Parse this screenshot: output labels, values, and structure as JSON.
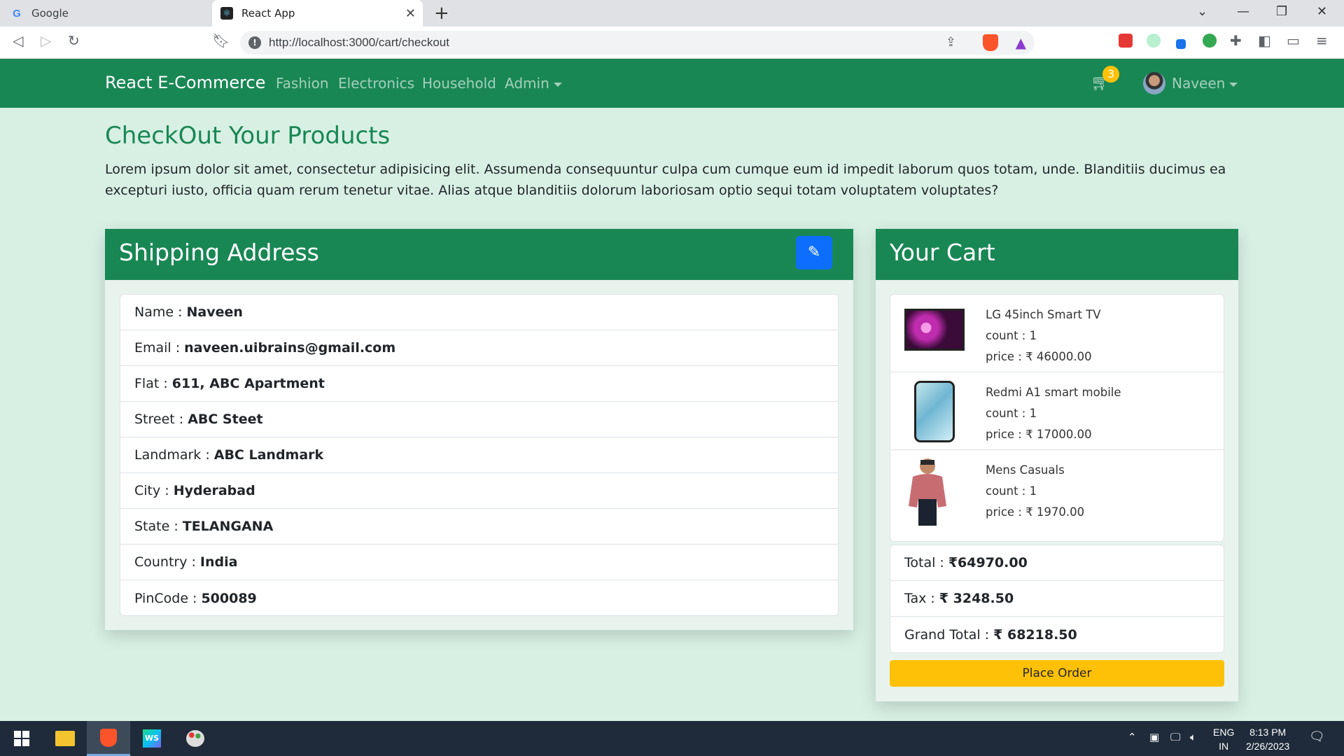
{
  "browser": {
    "tabs": [
      {
        "title": "Google",
        "icon": "google-icon",
        "active": false
      },
      {
        "title": "React App",
        "icon": "react-icon",
        "active": true
      }
    ],
    "url": "http://localhost:3000/cart/checkout"
  },
  "navbar": {
    "brand": "React E-Commerce",
    "links": [
      "Fashion",
      "Electronics",
      "Household"
    ],
    "admin": "Admin",
    "cart_count": "3",
    "user": "Naveen",
    "bg_color": "#198754"
  },
  "page": {
    "title": "CheckOut Your Products",
    "intro": "Lorem ipsum dolor sit amet, consectetur adipisicing elit. Assumenda consequuntur culpa cum cumque eum id impedit laborum quos totam, unde. Blanditiis ducimus ea excepturi iusto, officia quam rerum tenetur vitae. Alias atque blanditiis dolorum laboriosam optio sequi totam voluptatem voluptates?"
  },
  "shipping": {
    "title": "Shipping Address",
    "fields": [
      {
        "label": "Name :",
        "value": "Naveen"
      },
      {
        "label": "Email :",
        "value": "naveen.uibrains@gmail.com"
      },
      {
        "label": "Flat :",
        "value": "611, ABC Apartment"
      },
      {
        "label": "Street :",
        "value": "ABC Steet"
      },
      {
        "label": "Landmark :",
        "value": "ABC Landmark"
      },
      {
        "label": "City :",
        "value": "Hyderabad"
      },
      {
        "label": "State :",
        "value": "TELANGANA"
      },
      {
        "label": "Country :",
        "value": "India"
      },
      {
        "label": "PinCode :",
        "value": "500089"
      }
    ]
  },
  "cart": {
    "title": "Your Cart",
    "items": [
      {
        "name": "LG 45inch Smart TV",
        "count": "count : 1",
        "price": "price : ₹ 46000.00",
        "icon": "tv-image"
      },
      {
        "name": "Redmi A1 smart mobile",
        "count": "count : 1",
        "price": "price : ₹ 17000.00",
        "icon": "phone-image"
      },
      {
        "name": "Mens Casuals",
        "count": "count : 1",
        "price": "price : ₹ 1970.00",
        "icon": "shirt-image"
      }
    ],
    "totals": [
      {
        "label": "Total :",
        "value": "₹64970.00"
      },
      {
        "label": "Tax :",
        "value": "₹ 3248.50"
      },
      {
        "label": "Grand Total :",
        "value": "₹ 68218.50"
      }
    ],
    "place_order": "Place Order"
  },
  "taskbar": {
    "lang_line1": "ENG",
    "lang_line2": "IN",
    "time": "8:13 PM",
    "date": "2/26/2023"
  }
}
